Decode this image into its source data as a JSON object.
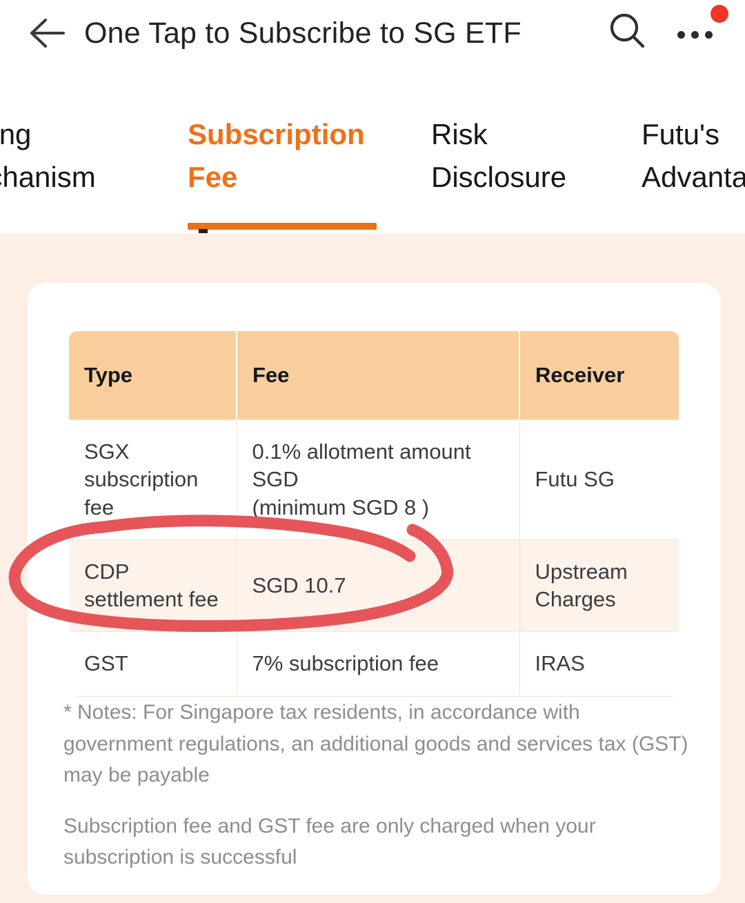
{
  "appbar": {
    "title": "One Tap to Subscribe to SG ETF",
    "back_icon": "back-arrow-icon",
    "search_icon": "search-icon",
    "more_icon": "more-options-icon",
    "notification_badge": ""
  },
  "tabs": [
    {
      "label": "ssuing\nMechanism",
      "active": false
    },
    {
      "label": "Subscription\nFee",
      "active": true
    },
    {
      "label": "Risk\nDisclosure",
      "active": false
    },
    {
      "label": "Futu's\nAdvantag",
      "active": false
    }
  ],
  "fee_table": {
    "headers": [
      "Type",
      "Fee",
      "Receiver"
    ],
    "rows": [
      {
        "type": "SGX\nsubscription fee",
        "fee": "0.1% allotment amount SGD\n(minimum SGD 8 )",
        "receiver": "Futu SG",
        "highlighted": false
      },
      {
        "type": "CDP\nsettlement fee",
        "fee": "SGD 10.7",
        "receiver": "Upstream\nCharges",
        "highlighted": true
      },
      {
        "type": "GST",
        "fee": "7% subscription fee",
        "receiver": "IRAS",
        "highlighted": false
      }
    ]
  },
  "notes": [
    "* Notes: For Singapore tax residents, in accordance with government regulations, an additional goods and services tax (GST) may be payable",
    "Subscription fee and GST fee are only charged when your subscription is successful"
  ],
  "annotation": {
    "name": "red-circle-highlight",
    "color": "#E5555A",
    "target": "CDP settlement fee row"
  },
  "colors": {
    "accent": "#F07017",
    "tab_underline": "#E8711A",
    "page_background": "#FDEFE5",
    "card_background": "#FFFFFF",
    "table_header": "#FACE9C",
    "row_highlight": "#FDF3EB",
    "notification": "#F03428",
    "annotation": "#E5555A"
  }
}
